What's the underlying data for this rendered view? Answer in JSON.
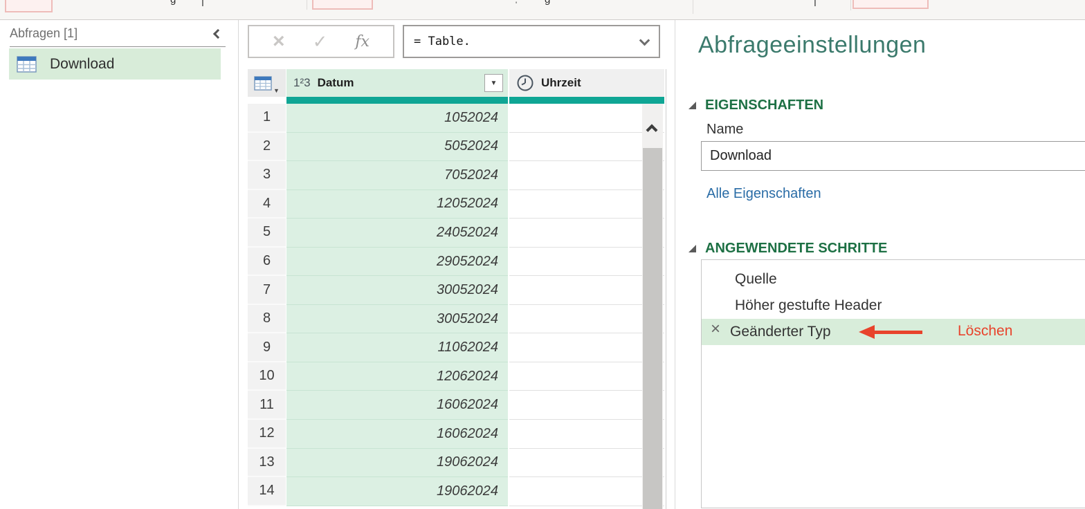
{
  "colors": {
    "accent_teal": "#0fa695",
    "selection_green": "#d8ecd9",
    "cell_green": "#dcf0e3",
    "section_green": "#1d7044",
    "title_teal": "#3b7a6c",
    "link_blue": "#2a6ca6",
    "annotation_red": "#e8432c"
  },
  "queries_pane": {
    "header": "Abfragen [1]",
    "items": [
      {
        "label": "Download",
        "selected": true
      }
    ]
  },
  "formula_bar": {
    "cancel_glyph": "×",
    "confirm_glyph": "✓",
    "fx_label": "fx",
    "formula": "= Table."
  },
  "data_grid": {
    "filter_glyph": "▼",
    "corner_dropdown_glyph": "▼",
    "columns": [
      {
        "name": "Datum",
        "type": "whole-number",
        "type_glyph": "1²3",
        "selected": true
      },
      {
        "name": "Uhrzeit",
        "type": "time",
        "selected": false
      }
    ],
    "rows": [
      {
        "num": 1,
        "datum": "1052024",
        "uhrzeit": ""
      },
      {
        "num": 2,
        "datum": "5052024",
        "uhrzeit": ""
      },
      {
        "num": 3,
        "datum": "7052024",
        "uhrzeit": ""
      },
      {
        "num": 4,
        "datum": "12052024",
        "uhrzeit": ""
      },
      {
        "num": 5,
        "datum": "24052024",
        "uhrzeit": ""
      },
      {
        "num": 6,
        "datum": "29052024",
        "uhrzeit": ""
      },
      {
        "num": 7,
        "datum": "30052024",
        "uhrzeit": ""
      },
      {
        "num": 8,
        "datum": "30052024",
        "uhrzeit": ""
      },
      {
        "num": 9,
        "datum": "11062024",
        "uhrzeit": ""
      },
      {
        "num": 10,
        "datum": "12062024",
        "uhrzeit": ""
      },
      {
        "num": 11,
        "datum": "16062024",
        "uhrzeit": ""
      },
      {
        "num": 12,
        "datum": "16062024",
        "uhrzeit": ""
      },
      {
        "num": 13,
        "datum": "19062024",
        "uhrzeit": ""
      },
      {
        "num": 14,
        "datum": "19062024",
        "uhrzeit": ""
      }
    ]
  },
  "settings_pane": {
    "title": "Abfrageeinstellungen",
    "properties_header": "EIGENSCHAFTEN",
    "name_label": "Name",
    "name_value": "Download",
    "all_properties_link": "Alle Eigenschaften",
    "steps_header": "ANGEWENDETE SCHRITTE",
    "steps": [
      {
        "label": "Quelle",
        "selected": false
      },
      {
        "label": "Höher gestufte Header",
        "selected": false
      },
      {
        "label": "Geänderter Typ",
        "selected": true,
        "delete_glyph": "×"
      }
    ],
    "annotation_label": "Löschen"
  }
}
